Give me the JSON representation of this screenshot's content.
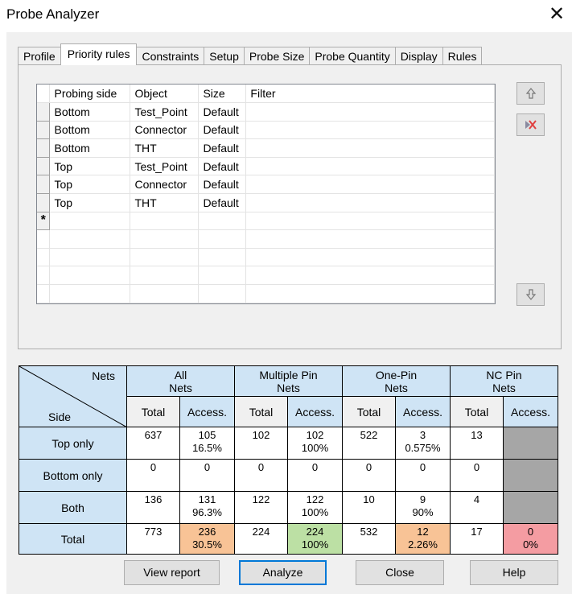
{
  "window": {
    "title": "Probe Analyzer",
    "close_glyph": "✕"
  },
  "tabs": [
    "Profile",
    "Priority rules",
    "Constraints",
    "Setup",
    "Probe Size",
    "Probe Quantity",
    "Display",
    "Rules"
  ],
  "active_tab": "Priority rules",
  "rules_grid": {
    "columns": [
      "Probing side",
      "Object",
      "Size",
      "Filter"
    ],
    "rows": [
      [
        "Bottom",
        "Test_Point",
        "Default",
        ""
      ],
      [
        "Bottom",
        "Connector",
        "Default",
        ""
      ],
      [
        "Bottom",
        "THT",
        "Default",
        ""
      ],
      [
        "Top",
        "Test_Point",
        "Default",
        ""
      ],
      [
        "Top",
        "Connector",
        "Default",
        ""
      ],
      [
        "Top",
        "THT",
        "Default",
        ""
      ]
    ],
    "new_row_marker": "*"
  },
  "side_buttons": {
    "move_up_icon": "arrow-up-icon",
    "delete_icon": "delete-row-icon",
    "move_down_icon": "arrow-down-icon"
  },
  "summary": {
    "corner_top": "Nets",
    "corner_bottom": "Side",
    "categories": [
      {
        "line1": "All",
        "line2": "Nets"
      },
      {
        "line1": "Multiple Pin",
        "line2": "Nets"
      },
      {
        "line1": "One-Pin",
        "line2": "Nets"
      },
      {
        "line1": "NC Pin",
        "line2": "Nets"
      }
    ],
    "sub_total": "Total",
    "sub_access": "Access.",
    "rows": [
      {
        "label": "Top only",
        "cells": [
          {
            "v1": "637"
          },
          {
            "v1": "105",
            "v2": "16.5%"
          },
          {
            "v1": "102"
          },
          {
            "v1": "102",
            "v2": "100%"
          },
          {
            "v1": "522"
          },
          {
            "v1": "3",
            "v2": "0.575%"
          },
          {
            "v1": "13"
          },
          {
            "v1": ""
          }
        ]
      },
      {
        "label": "Bottom only",
        "cells": [
          {
            "v1": "0"
          },
          {
            "v1": "0"
          },
          {
            "v1": "0"
          },
          {
            "v1": "0"
          },
          {
            "v1": "0"
          },
          {
            "v1": "0"
          },
          {
            "v1": "0"
          },
          {
            "v1": ""
          }
        ]
      },
      {
        "label": "Both",
        "cells": [
          {
            "v1": "136"
          },
          {
            "v1": "131",
            "v2": "96.3%"
          },
          {
            "v1": "122"
          },
          {
            "v1": "122",
            "v2": "100%"
          },
          {
            "v1": "10"
          },
          {
            "v1": "9",
            "v2": "90%"
          },
          {
            "v1": "4"
          },
          {
            "v1": ""
          }
        ]
      },
      {
        "label": "Total",
        "cells": [
          {
            "v1": "773"
          },
          {
            "v1": "236",
            "v2": "30.5%"
          },
          {
            "v1": "224"
          },
          {
            "v1": "224",
            "v2": "100%"
          },
          {
            "v1": "532"
          },
          {
            "v1": "12",
            "v2": "2.26%"
          },
          {
            "v1": "17"
          },
          {
            "v1": "0",
            "v2": "0%"
          }
        ]
      }
    ],
    "colors": {
      "header": "#cfe4f5",
      "orange": "#f8c396",
      "green": "#bce0a4",
      "red": "#f49ca2",
      "gray": "#a6a6a6"
    }
  },
  "buttons": {
    "view_report": "View report",
    "analyze": "Analyze",
    "close": "Close",
    "help": "Help"
  }
}
